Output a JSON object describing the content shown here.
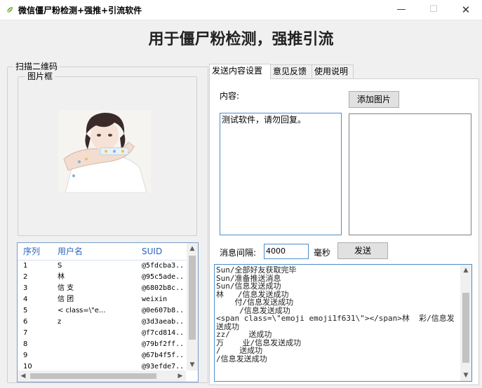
{
  "window": {
    "title": "微信僵尸粉检测+强推+引流软件",
    "min_symbol": "—",
    "max_symbol": "☐",
    "close_symbol": "✕"
  },
  "headline": "用于僵尸粉检测，强推引流",
  "qr_group": {
    "label": "扫描二维码",
    "picture_label": "图片框"
  },
  "list": {
    "columns": [
      "序列",
      "用户名",
      "SUID"
    ],
    "rows": [
      {
        "index": "1",
        "name": "S",
        "suid": "@5fdcba3..."
      },
      {
        "index": "2",
        "name": "林",
        "suid": "@95c5ade..."
      },
      {
        "index": "3",
        "name": "信 支",
        "suid": "@6802b8c..."
      },
      {
        "index": "4",
        "name": "信 团",
        "suid": "weixin"
      },
      {
        "index": "5",
        "name": "<  class=\\\"e...",
        "suid": "@0e607b8..."
      },
      {
        "index": "6",
        "name": "z",
        "suid": "@3d3aeab..."
      },
      {
        "index": "7",
        "name": "",
        "suid": "@f7cd814..."
      },
      {
        "index": "8",
        "name": "",
        "suid": "@79bf2ff..."
      },
      {
        "index": "9",
        "name": "",
        "suid": "@67b4f5f..."
      },
      {
        "index": "10",
        "name": "",
        "suid": "@93efde7..."
      }
    ]
  },
  "tabs": [
    {
      "label": "发送内容设置",
      "active": true
    },
    {
      "label": "意见反馈",
      "active": false
    },
    {
      "label": "使用说明",
      "active": false
    }
  ],
  "send_panel": {
    "content_label": "内容:",
    "add_image_button": "添加图片",
    "message_text": "测试软件，请勿回复。",
    "interval_label": "消息间隔:",
    "interval_value": "4000",
    "interval_unit": "毫秒",
    "send_button": "发送"
  },
  "log": [
    "Sun/全部好友获取完毕",
    "Sun/准备推送消息",
    "Sun/信息发送成功",
    "林   /信息发送成功",
    "    付/信息发送成功",
    "     /信息发送成功",
    "<span class=\\\"emoji emoji1f631\\\"></span>林  彩/信息发送成功",
    "zz/    送成功",
    "万    业/信息发送成功",
    "/    送成功",
    "/信息发送成功"
  ],
  "colors": {
    "accent_blue": "#2a63c2",
    "focus_border": "#4d8ec8",
    "window_bg": "#f0f0f0"
  }
}
